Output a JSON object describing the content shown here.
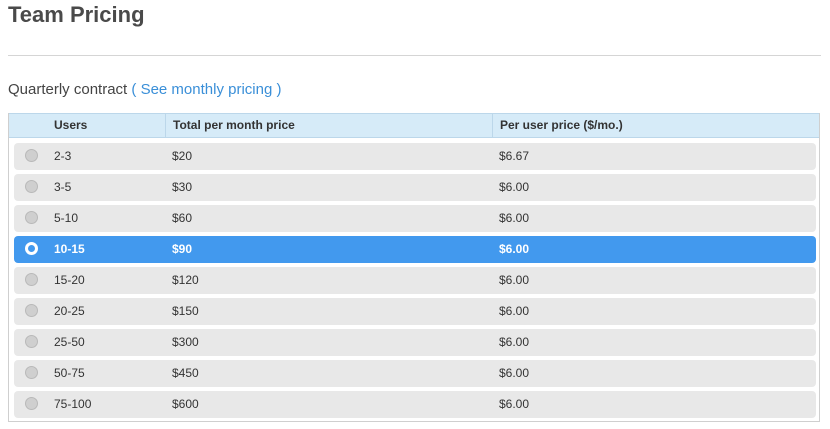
{
  "page": {
    "title": "Team Pricing"
  },
  "contract": {
    "prefix": "Quarterly contract",
    "open_paren": "(",
    "link_label": "See monthly pricing",
    "close_paren": ")"
  },
  "table": {
    "headers": [
      "Users",
      "Total per month price",
      "Per user price ($/mo.)"
    ],
    "selected_index": 3,
    "rows": [
      {
        "users": "2-3",
        "total": "$20",
        "per_user": "$6.67"
      },
      {
        "users": "3-5",
        "total": "$30",
        "per_user": "$6.00"
      },
      {
        "users": "5-10",
        "total": "$60",
        "per_user": "$6.00"
      },
      {
        "users": "10-15",
        "total": "$90",
        "per_user": "$6.00"
      },
      {
        "users": "15-20",
        "total": "$120",
        "per_user": "$6.00"
      },
      {
        "users": "20-25",
        "total": "$150",
        "per_user": "$6.00"
      },
      {
        "users": "25-50",
        "total": "$300",
        "per_user": "$6.00"
      },
      {
        "users": "50-75",
        "total": "$450",
        "per_user": "$6.00"
      },
      {
        "users": "75-100",
        "total": "$600",
        "per_user": "$6.00"
      }
    ]
  },
  "colors": {
    "accent": "#4299ee",
    "link": "#3a8fd8",
    "header_bg": "#d6ebf8",
    "row_bg": "#e8e8e8"
  }
}
